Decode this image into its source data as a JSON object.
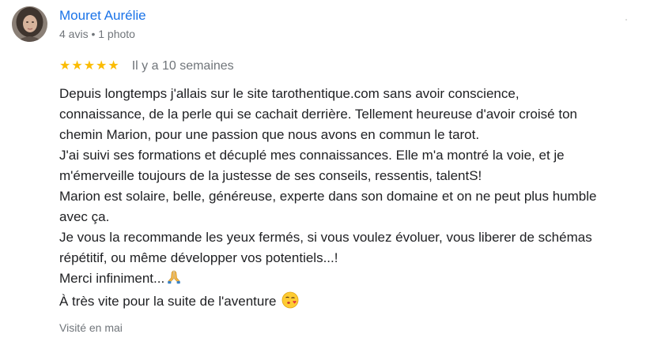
{
  "review": {
    "author_name": "Mouret Aurélie",
    "author_meta": "4 avis • 1 photo",
    "rating": 5,
    "rating_max": 5,
    "star_glyph": "★",
    "star_color": "#fbbc04",
    "date": "Il y a 10 semaines",
    "body_lines": [
      "Depuis longtemps j'allais sur le site tarothentique.com sans avoir conscience,",
      "connaissance, de la perle qui se cachait derrière. Tellement heureuse d'avoir croisé ton",
      "chemin Marion, pour une passion que nous avons en commun le tarot.",
      "J'ai suivi ses formations et décuplé mes connaissances. Elle m'a montré la voie, et je",
      "m'émerveille toujours de la justesse de ses conseils, ressentis, talentS!",
      "Marion est solaire, belle, généreuse, experte dans son domaine et on ne peut plus humble",
      "avec ça.",
      "Je vous la recommande les yeux fermés, si vous voulez évoluer, vous liberer de schémas",
      "répétitif, ou même développer vos potentiels...!",
      "Merci infiniment...",
      "À très vite pour la suite de l'aventure"
    ],
    "emojis": {
      "thanks": "praying-hands-icon",
      "closing": "face-blowing-kiss-icon"
    },
    "visited": "Visité en mai",
    "name_color": "#1a73e8",
    "muted_color": "#70757a"
  }
}
